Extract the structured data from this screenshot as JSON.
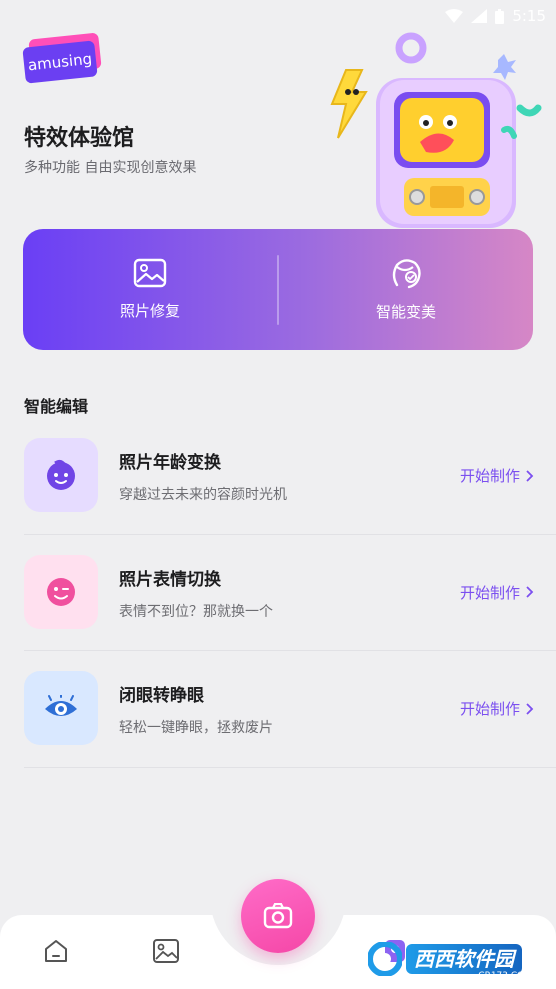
{
  "status_bar": {
    "time": "5:15"
  },
  "brand": {
    "badge": "amusing"
  },
  "hero": {
    "title": "特效体验馆",
    "subtitle": "多种功能 自由实现创意效果"
  },
  "features": [
    {
      "label": "照片修复",
      "icon": "image-icon"
    },
    {
      "label": "智能变美",
      "icon": "face-beauty-icon"
    }
  ],
  "section": {
    "title": "智能编辑"
  },
  "tools": [
    {
      "name": "照片年龄变换",
      "desc": "穿越过去未来的容颜时光机",
      "action": "开始制作",
      "icon": "baby-face-icon",
      "bg": "#e6dcff",
      "fg": "#7045e6"
    },
    {
      "name": "照片表情切换",
      "desc": "表情不到位？那就换一个",
      "action": "开始制作",
      "icon": "wink-face-icon",
      "bg": "#ffe0ef",
      "fg": "#f0509e"
    },
    {
      "name": "闭眼转睁眼",
      "desc": "轻松一键睁眼，拯救废片",
      "action": "开始制作",
      "icon": "eye-icon",
      "bg": "#d9e8ff",
      "fg": "#2f6fd6"
    }
  ],
  "bottom_nav": {
    "items": [
      "home-icon",
      "gallery-icon",
      "camera-icon",
      "profile-icon"
    ]
  },
  "watermark": {
    "text": "西西软件园",
    "sub": "CR173.COM"
  },
  "colors": {
    "accent": "#7b4ff0",
    "card_gradient_start": "#6a3ff5",
    "card_gradient_end": "#d687c6",
    "fab": "#f547a7"
  }
}
